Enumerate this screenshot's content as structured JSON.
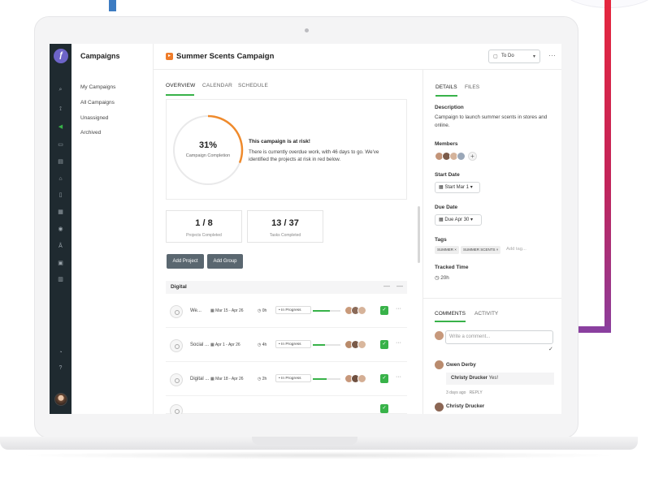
{
  "sidebar": {
    "logo_icon": "feather-logo-icon",
    "title": "Campaigns",
    "items": [
      {
        "label": "My Campaigns"
      },
      {
        "label": "All Campaigns"
      },
      {
        "label": "Unassigned"
      },
      {
        "label": "Archived"
      }
    ],
    "rail_icons": [
      "search-icon",
      "activity-icon",
      "campaign-icon",
      "folder-icon",
      "document-icon",
      "inbox-icon",
      "bookmark-icon",
      "calendar-icon",
      "location-icon",
      "user-icon",
      "report-icon",
      "chart-icon",
      "bell-icon",
      "help-icon"
    ]
  },
  "header": {
    "title": "Summer Scents Campaign",
    "status": "To Do"
  },
  "main": {
    "tabs": [
      {
        "label": "OVERVIEW"
      },
      {
        "label": "CALENDAR"
      },
      {
        "label": "SCHEDULE"
      }
    ],
    "progress": {
      "percent": "31%",
      "percent_value": 0.31,
      "label": "Campaign Completion",
      "risk_title": "This campaign is at risk!",
      "risk_text": "There is currently overdue work, with 46 days to go. We've identified the projects at risk in red below."
    },
    "stats": [
      {
        "value": "1 / 8",
        "label": "Projects Completed"
      },
      {
        "value": "13 / 37",
        "label": "Tasks Completed"
      }
    ],
    "buttons": {
      "add_project": "Add Project",
      "add_group": "Add Group"
    },
    "group": {
      "name": "Digital",
      "collapse": "—",
      "minimize": "—"
    },
    "projects": [
      {
        "name": "We...",
        "date": "Mar 15 - Apr 26",
        "hours": "0h",
        "status": "• In Progress",
        "progress": 0.62
      },
      {
        "name": "Social ...",
        "date": "Apr 1 - Apr 26",
        "hours": "4h",
        "status": "• In Progress",
        "progress": 0.45
      },
      {
        "name": "Digital ...",
        "date": "Mar 18 - Apr 26",
        "hours": "2h",
        "status": "• In Progress",
        "progress": 0.5
      }
    ],
    "row_more": "···"
  },
  "details": {
    "tabs": [
      {
        "label": "DETAILS"
      },
      {
        "label": "FILES"
      }
    ],
    "description_label": "Description",
    "description": "Campaign to launch summer scents in stores and online.",
    "members_label": "Members",
    "start_label": "Start Date",
    "start_value": "Start Mar 1",
    "due_label": "Due Date",
    "due_value": "Due Apr 30",
    "tags_label": "Tags",
    "tags": [
      "SUMMER ×",
      "SUMMER SCENTS ×"
    ],
    "add_tag": "Add tag...",
    "tracked_label": "Tracked Time",
    "tracked_value": "20h"
  },
  "comments": {
    "tabs": [
      {
        "label": "COMMENTS"
      },
      {
        "label": "ACTIVITY"
      }
    ],
    "placeholder": "Write a comment...",
    "items": [
      {
        "author": "Gwen Derby",
        "mention": "Christy Drucker",
        "text": "Yes!",
        "time": "3 days ago",
        "reply": "REPLY"
      },
      {
        "author": "Christy Drucker"
      }
    ]
  },
  "colors": {
    "accent": "#38b249",
    "rail": "#1f2a30",
    "ring_progress": "#ef8a2c",
    "campaign_icon": "#ef7c2a",
    "button": "#5a6770"
  }
}
